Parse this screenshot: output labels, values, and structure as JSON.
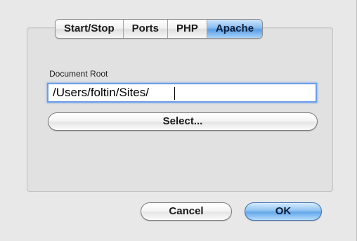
{
  "tabs": [
    {
      "label": "Start/Stop",
      "active": false
    },
    {
      "label": "Ports",
      "active": false
    },
    {
      "label": "PHP",
      "active": false
    },
    {
      "label": "Apache",
      "active": true
    }
  ],
  "apache": {
    "document_root_label": "Document Root",
    "document_root_value": "/Users/foltin/Sites/",
    "select_label": "Select..."
  },
  "footer": {
    "cancel_label": "Cancel",
    "ok_label": "OK"
  },
  "colors": {
    "active_tab": "#5a9fe5",
    "default_button": "#64a8ea",
    "focus_ring": "#6d9ee8"
  }
}
